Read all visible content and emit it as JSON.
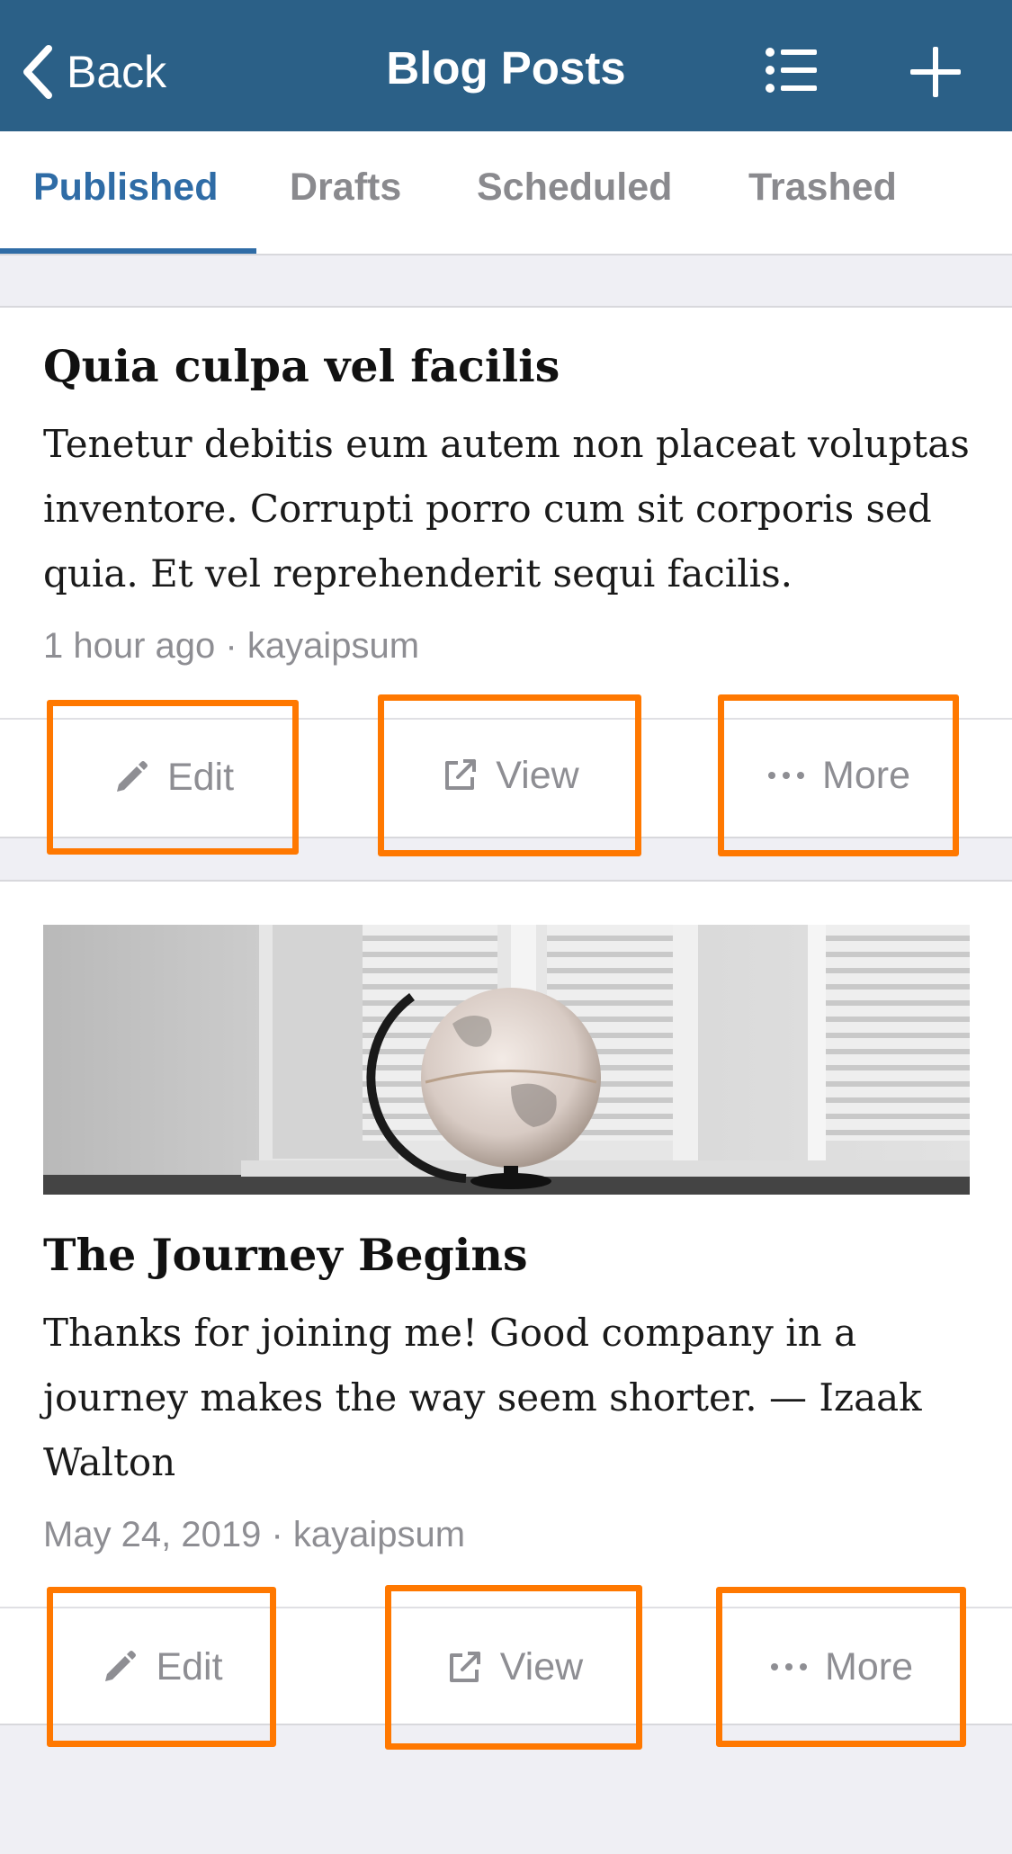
{
  "navbar": {
    "back_label": "Back",
    "title": "Blog Posts",
    "list_icon": "list-icon",
    "add_icon": "plus-icon"
  },
  "tabs": [
    {
      "label": "Published",
      "active": true
    },
    {
      "label": "Drafts",
      "active": false
    },
    {
      "label": "Scheduled",
      "active": false
    },
    {
      "label": "Trashed",
      "active": false
    }
  ],
  "posts": [
    {
      "title": "Quia culpa vel facilis",
      "excerpt": "Tenetur debitis eum autem non placeat voluptas inventore. Corrupti porro cum sit corporis sed quia. Et vel reprehenderit sequi facilis.",
      "meta": "1 hour ago · kayaipsum",
      "has_image": false,
      "actions": {
        "edit": "Edit",
        "view": "View",
        "more": "More"
      }
    },
    {
      "title": "The Journey Begins",
      "excerpt": "Thanks for joining me! Good company in a journey makes the way seem shorter. — Izaak Walton",
      "meta": "May 24, 2019 · kayaipsum",
      "has_image": true,
      "actions": {
        "edit": "Edit",
        "view": "View",
        "more": "More"
      }
    }
  ],
  "colors": {
    "navbar": "#2b6087",
    "accent": "#2f6ca6",
    "highlight": "#ff7800",
    "background": "#efeff4"
  }
}
